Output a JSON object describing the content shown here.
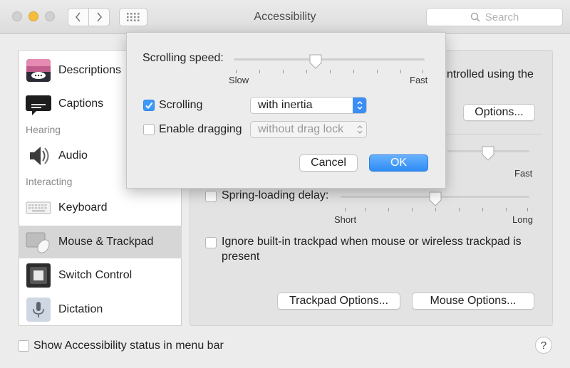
{
  "window": {
    "title": "Accessibility"
  },
  "search": {
    "placeholder": "Search"
  },
  "sidebar": {
    "items": [
      {
        "label": "Descriptions"
      },
      {
        "label": "Captions"
      },
      {
        "label": "Audio"
      },
      {
        "label": "Keyboard"
      },
      {
        "label": "Mouse & Trackpad",
        "selected": true
      },
      {
        "label": "Switch Control"
      },
      {
        "label": "Dictation"
      }
    ],
    "headings": {
      "hearing": "Hearing",
      "interacting": "Interacting"
    }
  },
  "main": {
    "partial_text": "ntrolled using the",
    "options_button": "Options...",
    "slider1_fast": "Fast",
    "spring_loading": {
      "label": "Spring-loading delay:",
      "checked": false,
      "min": "Short",
      "max": "Long",
      "value": 0.5
    },
    "ignore_trackpad": {
      "label_line1": "Ignore built-in trackpad when mouse or wireless trackpad is",
      "label_line2": "present",
      "checked": false
    },
    "trackpad_options": "Trackpad Options...",
    "mouse_options": "Mouse Options..."
  },
  "footer": {
    "show_status": "Show Accessibility status in menu bar",
    "show_status_checked": false,
    "help": "?"
  },
  "sheet": {
    "scrolling_speed_label": "Scrolling speed:",
    "speed_min": "Slow",
    "speed_max": "Fast",
    "speed_value": 0.43,
    "scrolling": {
      "label": "Scrolling",
      "checked": true,
      "select_value": "with inertia"
    },
    "dragging": {
      "label": "Enable dragging",
      "checked": false,
      "select_value": "without drag lock"
    },
    "cancel": "Cancel",
    "ok": "OK"
  },
  "colors": {
    "accent": "#3b99fc",
    "selection": "#d6d6d6"
  }
}
